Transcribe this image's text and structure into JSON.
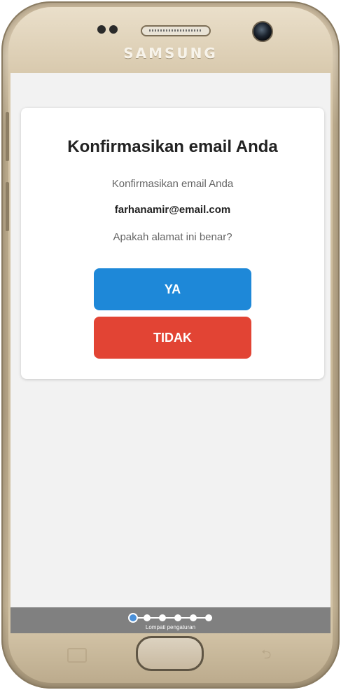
{
  "device": {
    "brand": "SAMSUNG"
  },
  "dialog": {
    "title": "Konfirmasikan email Anda",
    "subtitle": "Konfirmasikan email Anda",
    "email": "farhanamir@email.com",
    "question": "Apakah alamat ini benar?",
    "yes_label": "YA",
    "no_label": "TIDAK"
  },
  "progress": {
    "total_steps": 6,
    "current_step": 1,
    "skip_label": "Lompati pengaturan"
  },
  "colors": {
    "yes_button": "#1e88d8",
    "no_button": "#e24434",
    "screen_background": "#f2f2f2",
    "bottom_bar": "#808080",
    "active_dot": "#4a90d9"
  },
  "icons": {
    "recent_apps": "recent-apps-icon",
    "back": "back-icon"
  }
}
